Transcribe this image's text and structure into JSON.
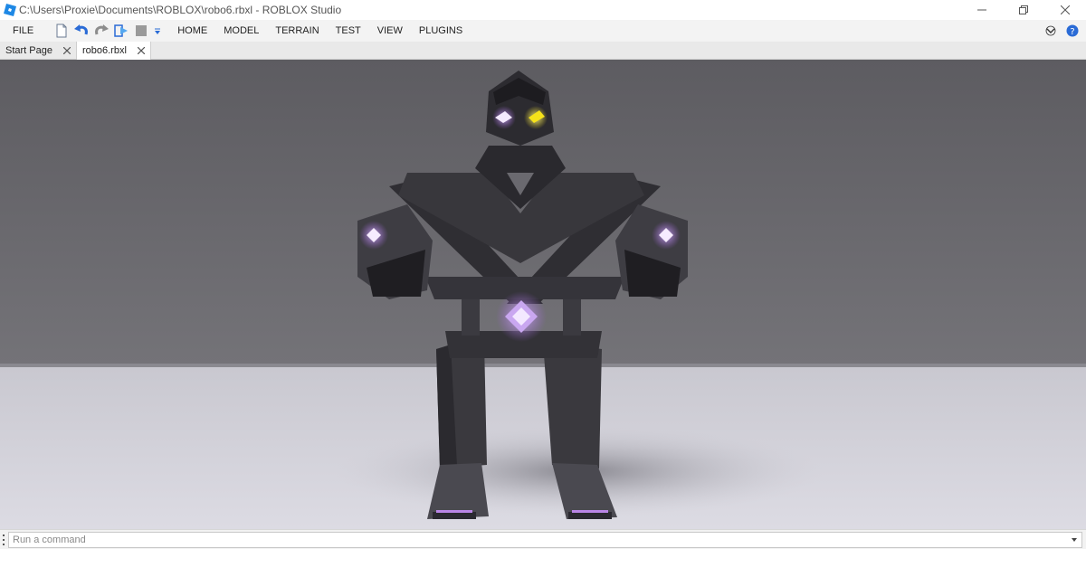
{
  "window": {
    "title": "C:\\Users\\Proxie\\Documents\\ROBLOX\\robo6.rbxl - ROBLOX Studio",
    "controls": [
      "minimize-icon",
      "restore-icon",
      "close-icon"
    ]
  },
  "menubar": {
    "file_label": "FILE",
    "quick_access_icons": [
      "new-file-icon",
      "undo-icon",
      "redo-icon",
      "play-icon",
      "stop-icon",
      "customize-dropdown-icon"
    ],
    "items": [
      "HOME",
      "MODEL",
      "TERRAIN",
      "TEST",
      "VIEW",
      "PLUGINS"
    ],
    "right_icons": [
      "collapse-ribbon-icon",
      "help-icon"
    ]
  },
  "tabs": [
    {
      "label": "Start Page",
      "active": false
    },
    {
      "label": "robo6.rbxl",
      "active": true
    }
  ],
  "command_bar": {
    "placeholder": "Run a command"
  },
  "colors": {
    "accent": "#1e88e5",
    "eye_yellow": "#f5e21a",
    "glow_purple": "#b985e6",
    "robot_body": "#3c3b40",
    "backdrop_wall": "#6e6d72",
    "floor": "#d5d4dc"
  }
}
